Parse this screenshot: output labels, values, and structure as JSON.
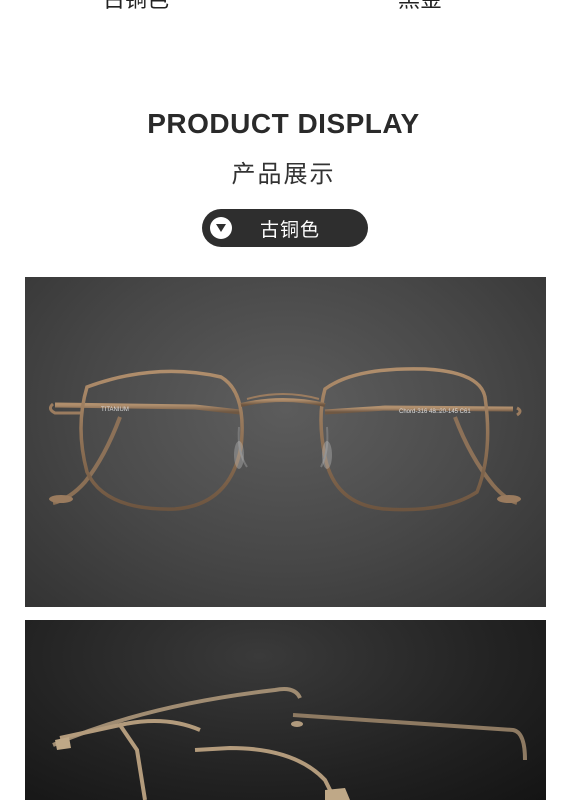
{
  "header_cut": {
    "left_label": "古铜色",
    "right_label": "黑金"
  },
  "section": {
    "title": "PRODUCT DISPLAY",
    "subtitle": "产品展示"
  },
  "color_selector": {
    "label": "古铜色",
    "icon": "triangle-down-icon"
  },
  "photos": {
    "frame_temple_print": "TITANIUM",
    "frame_model_print": "Chord-316  48□20-145  C61"
  },
  "colors": {
    "pill_bg": "#2e2e2e",
    "frame_bronze": "#8a6f55"
  }
}
